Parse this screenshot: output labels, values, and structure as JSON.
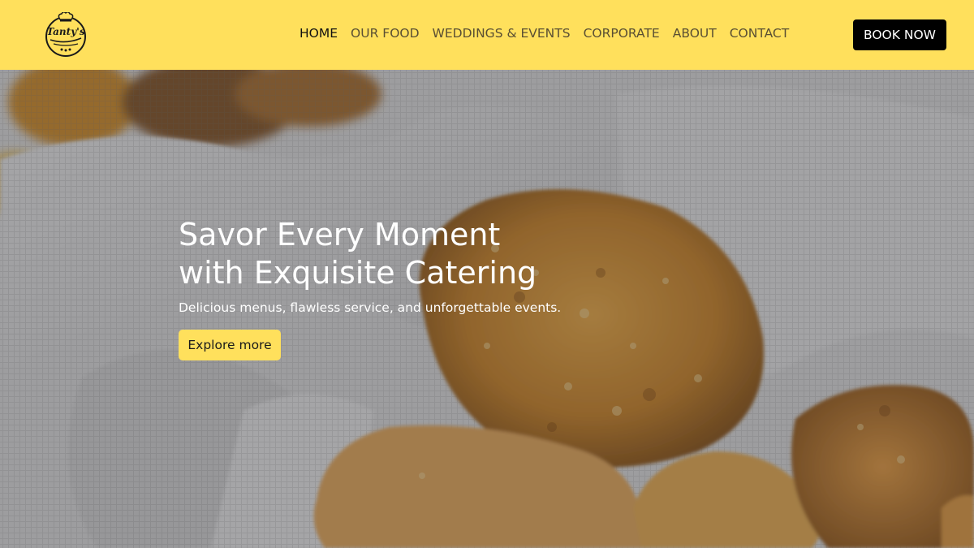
{
  "brand": {
    "logo_text": "Tanty's",
    "accent_color": "#ffe05c"
  },
  "nav": {
    "items": [
      {
        "label": "HOME",
        "active": true
      },
      {
        "label": "OUR FOOD",
        "active": false
      },
      {
        "label": "WEDDINGS & EVENTS",
        "active": false
      },
      {
        "label": "CORPORATE",
        "active": false
      },
      {
        "label": "ABOUT",
        "active": false
      },
      {
        "label": "CONTACT",
        "active": false
      }
    ],
    "book_label": "BOOK NOW"
  },
  "hero": {
    "title_line1": "Savor Every Moment",
    "title_line2": "with Exquisite Catering",
    "subtitle": "Delicious menus, flawless service, and unforgettable events.",
    "cta_label": "Explore more"
  }
}
